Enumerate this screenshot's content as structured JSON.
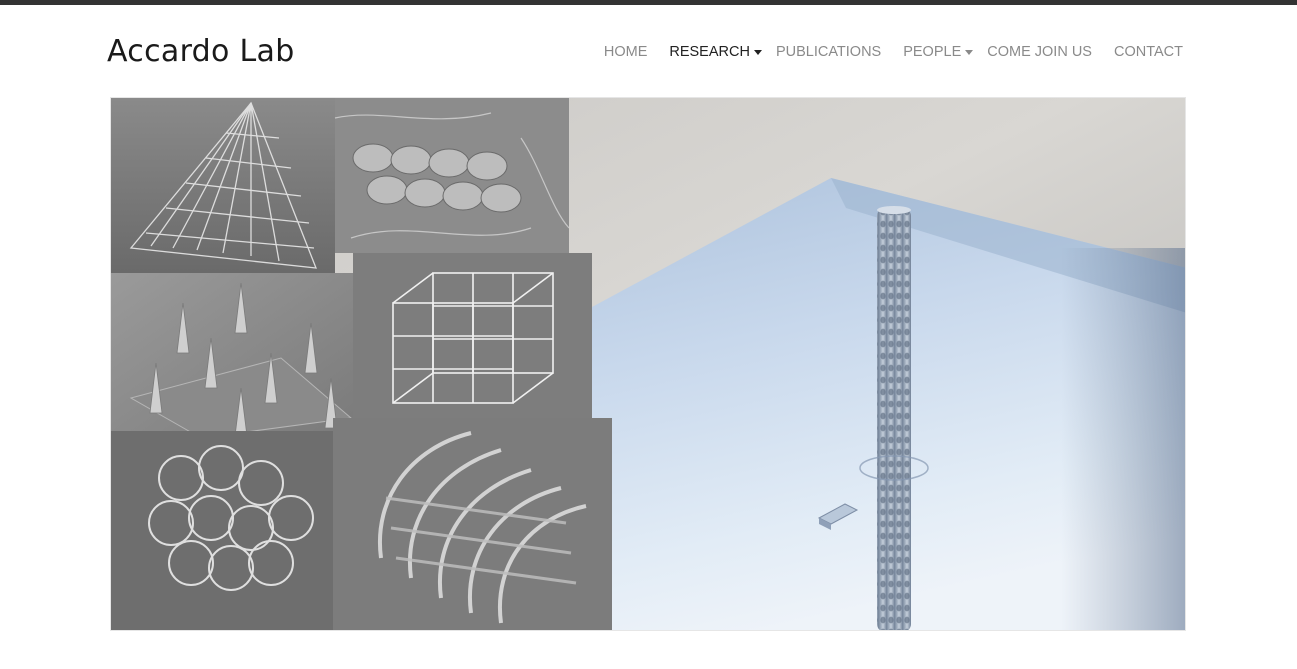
{
  "site": {
    "title": "Accardo Lab"
  },
  "nav": {
    "items": [
      {
        "label": "HOME"
      },
      {
        "label": "RESEARCH"
      },
      {
        "label": "PUBLICATIONS"
      },
      {
        "label": "PEOPLE"
      },
      {
        "label": "COME JOIN US"
      },
      {
        "label": "CONTACT"
      }
    ]
  },
  "colors": {
    "topbar": "#333333",
    "nav_text": "#8a8a8a",
    "nav_active": "#222222"
  }
}
